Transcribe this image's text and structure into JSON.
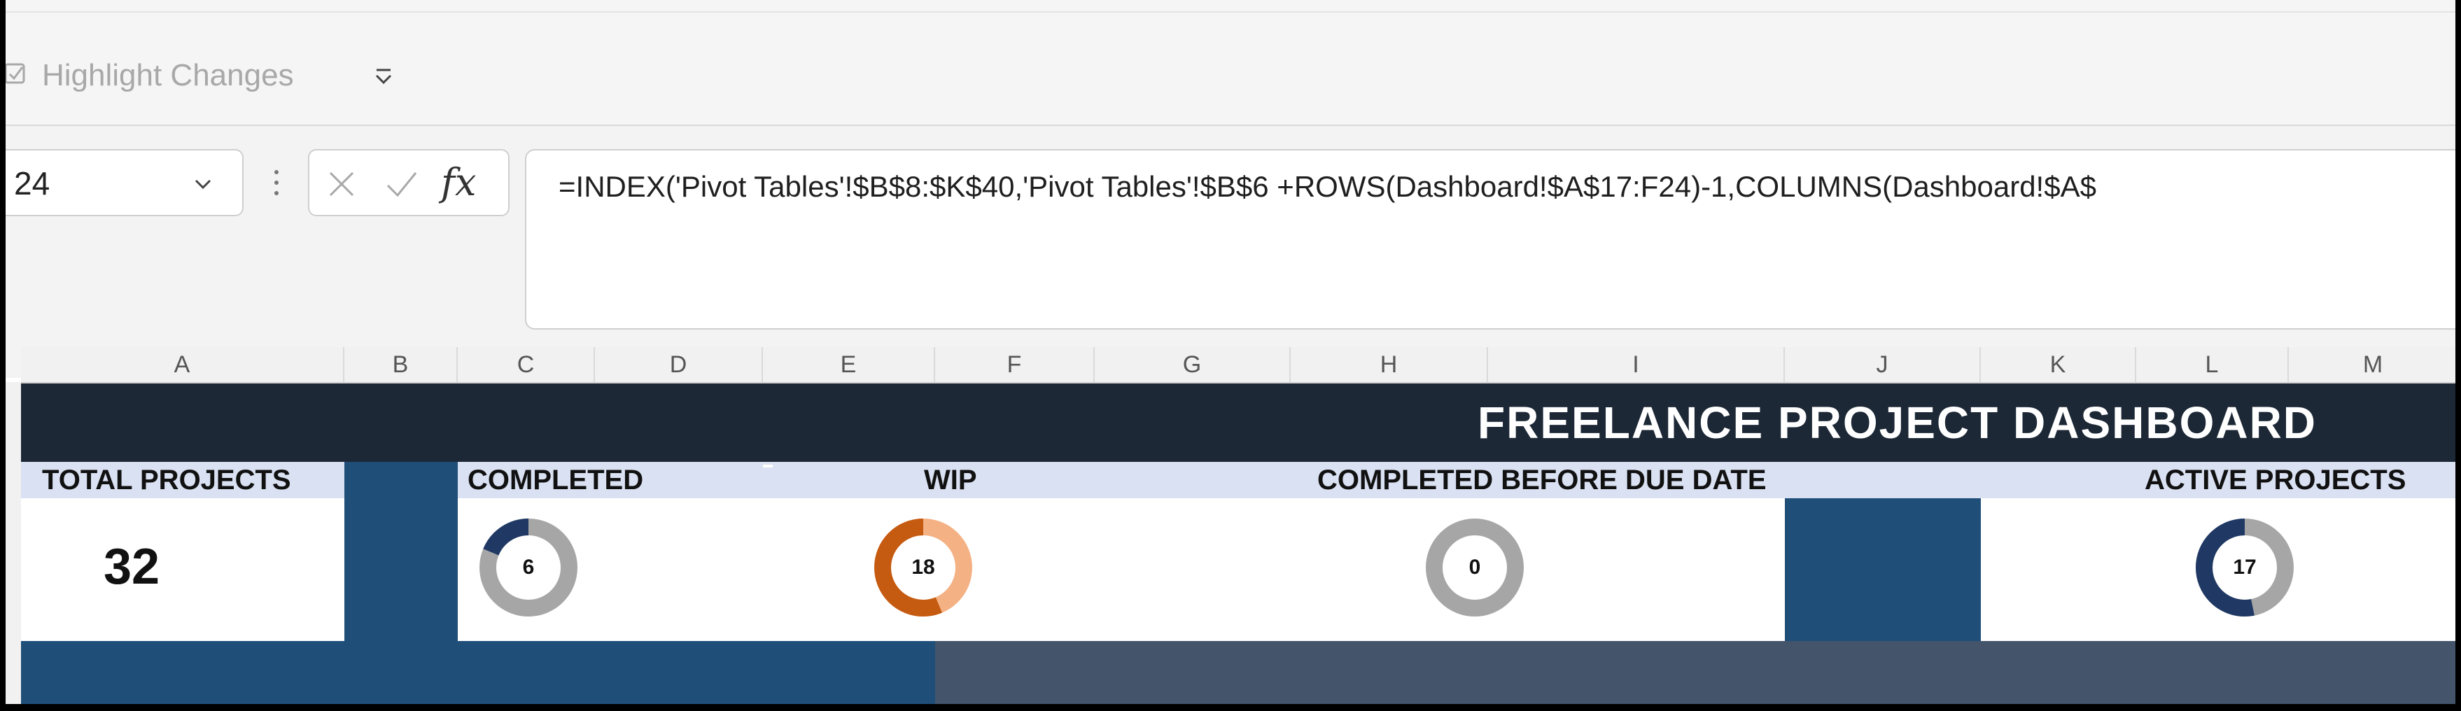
{
  "ribbon": {
    "highlight_changes_label": "Highlight Changes",
    "icons": [
      "highlight-changes-icon",
      "quick-access-dropdown-icon"
    ]
  },
  "formula_bar": {
    "name_box_value": "24",
    "formula": "=INDEX('Pivot Tables'!$B$8:$K$40,'Pivot Tables'!$B$6 +ROWS(Dashboard!$A$17:F24)-1,COLUMNS(Dashboard!$A$",
    "fx_label": "fx"
  },
  "columns": [
    "A",
    "B",
    "C",
    "D",
    "E",
    "F",
    "G",
    "H",
    "I",
    "J",
    "K",
    "L",
    "M"
  ],
  "dashboard": {
    "title": "FREELANCE PROJECT DASHBOARD",
    "total": {
      "label": "TOTAL PROJECTS",
      "value": "32"
    },
    "completed": {
      "label": "COMPLETED",
      "value": 6,
      "display": "6",
      "total": 32
    },
    "wip": {
      "label": "WIP",
      "value": 18,
      "display": "18",
      "total": 32
    },
    "before_due": {
      "label": "COMPLETED BEFORE DUE DATE",
      "value": 0,
      "display": "0",
      "total": 32
    },
    "active": {
      "label": "ACTIVE PROJECTS",
      "value": 17,
      "display": "17",
      "total": 32
    }
  },
  "colors": {
    "banner": "#1d2836",
    "label_band": "#d9e1f2",
    "block_blue": "#1f4e79",
    "slate": "#44546a",
    "donut_navy": "#1f3864",
    "donut_grey": "#a6a6a6",
    "donut_orange": "#c55a11",
    "donut_peach": "#f4b183"
  }
}
